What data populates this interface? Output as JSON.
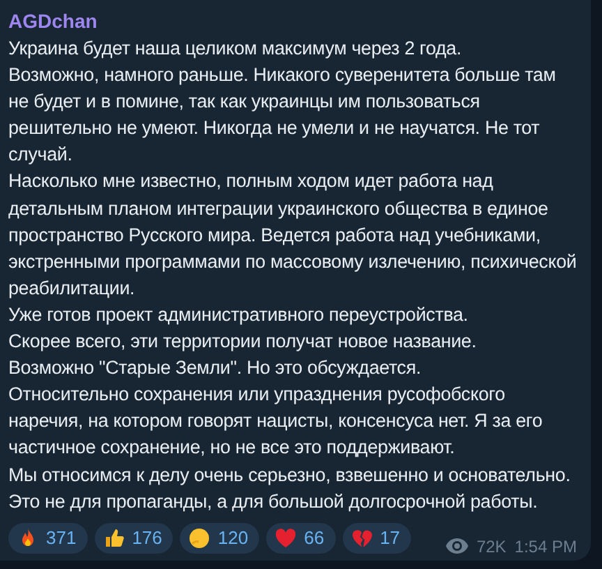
{
  "message": {
    "author": "AGDchan",
    "paragraphs": [
      "Украина будет наша целиком максимум через 2 года.",
      "Возможно, намного раньше. Никакого суверенитета больше там не будет и в помине, так как украинцы им пользоваться решительно не умеют. Никогда не умели и не научатся. Не тот случай.",
      "Насколько мне известно, полным ходом идет работа над детальным планом интеграции украинского общества в единое пространство Русского мира. Ведется работа над учебниками, экстренными программами по массовому излечению, психической реабилитации.",
      "Уже готов проект административного переустройства.",
      "Скорее всего, эти территории получат новое название.",
      "Возможно \"Старые Земли\". Но это обсуждается.",
      "Относительно сохранения или упразднения русофобского наречия, на котором говорят нацисты, консенсуса нет. Я за его частичное сохранение, но не все это поддерживают.",
      "Мы относимся к делу очень серьезно, взвешенно и основательно.",
      "Это не для пропаганды, а для большой долгосрочной работы."
    ],
    "reactions": [
      {
        "kind": "fire",
        "count": "371"
      },
      {
        "kind": "thumbs-up",
        "count": "176"
      },
      {
        "kind": "thinking",
        "count": "120"
      },
      {
        "kind": "heart",
        "count": "66"
      },
      {
        "kind": "broken-heart",
        "count": "17"
      }
    ],
    "views": "72K",
    "time": "1:54 PM"
  }
}
